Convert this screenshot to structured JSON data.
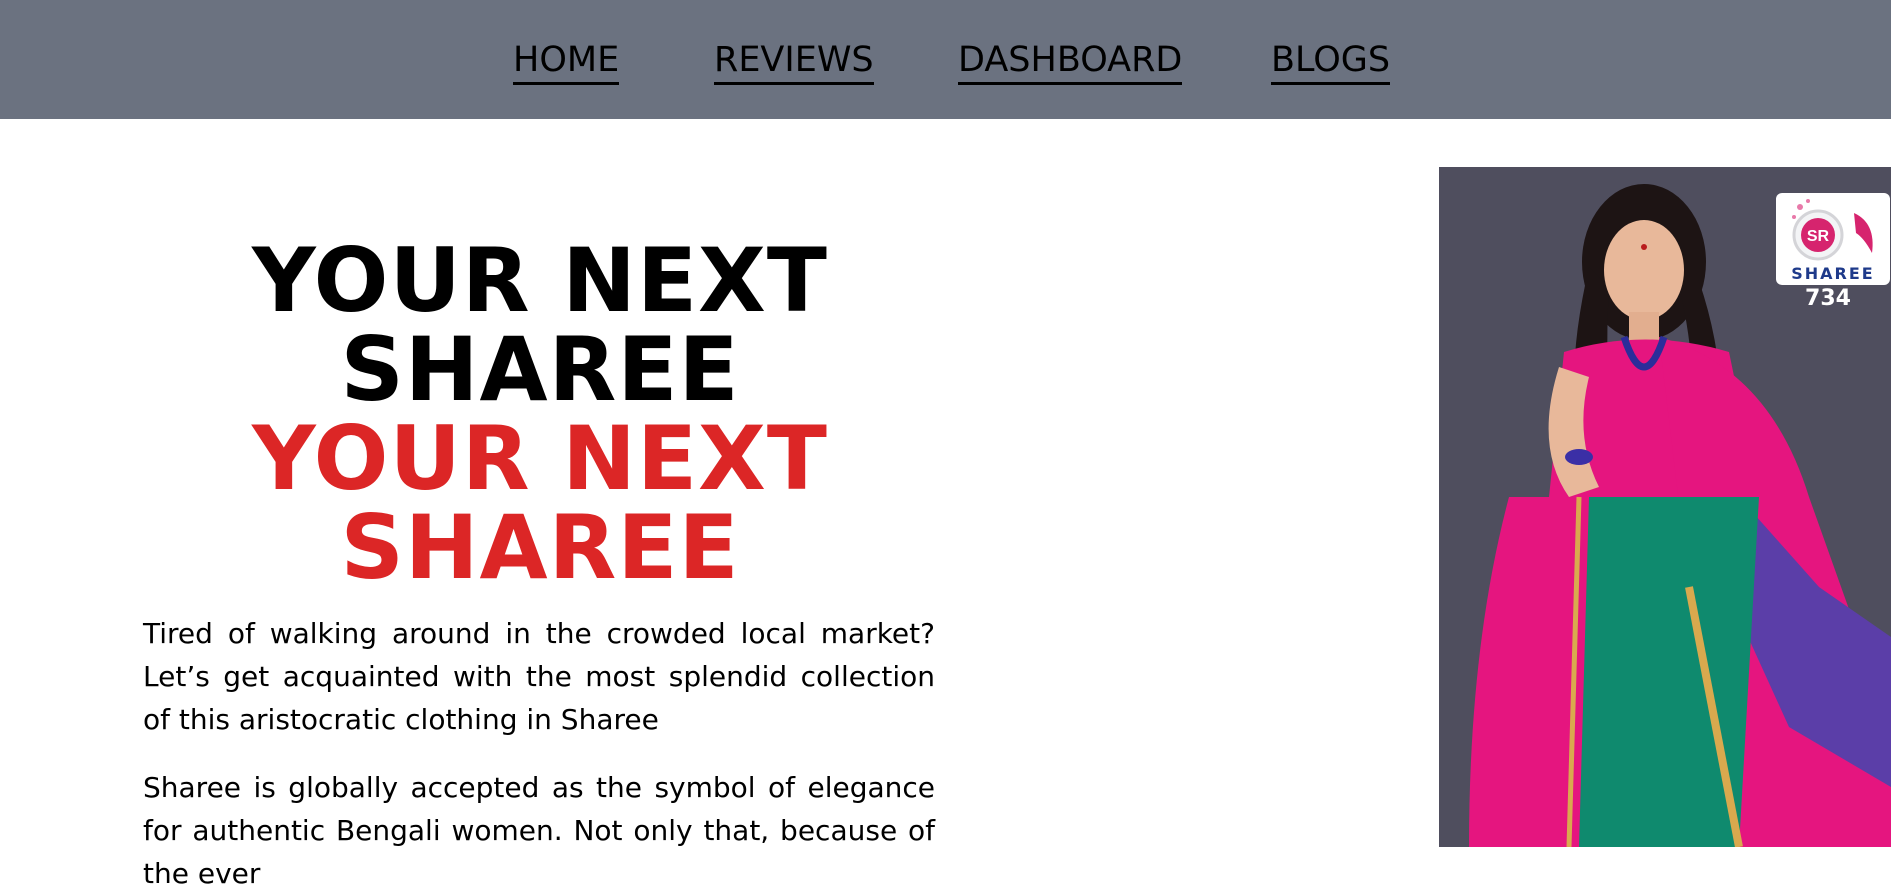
{
  "nav": {
    "items": [
      {
        "label": "HOME"
      },
      {
        "label": "REVIEWS"
      },
      {
        "label": "DASHBOARD"
      },
      {
        "label": "BLOGS"
      }
    ]
  },
  "hero": {
    "title_black_line1": "YOUR NEXT",
    "title_black_line2": "SHAREE",
    "title_red_line1": "YOUR NEXT",
    "title_red_line2": "SHAREE",
    "paragraph1": "Tired of walking around in the crowded local market? Let’s get acquainted with the most splendid collection of this aristocratic clothing in Sharee",
    "paragraph2": "Sharee is globally accepted as the symbol of elegance for authentic Bengali women. Not only that, because of the ever"
  },
  "image": {
    "logo_text": "SHAREE",
    "logo_monogram": "SR",
    "product_code": "734"
  },
  "colors": {
    "nav_bg": "#6b7280",
    "accent_red": "#dc2626",
    "image_bg": "#4f4e5e",
    "saree_pink": "#e5157f",
    "saree_green": "#0f8a6e",
    "saree_purple": "#5b3ea8"
  }
}
